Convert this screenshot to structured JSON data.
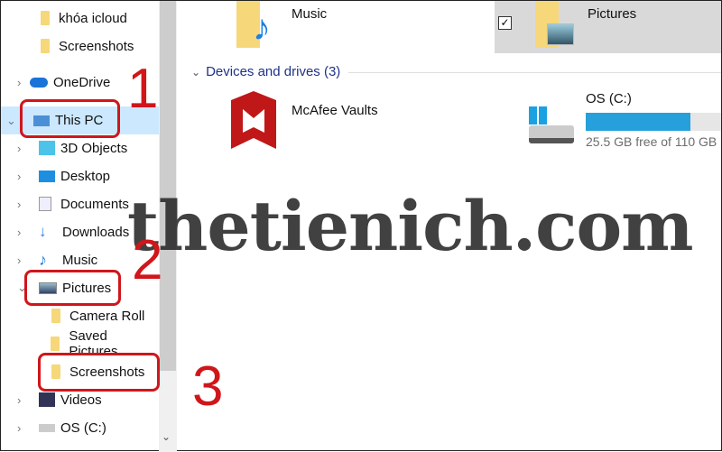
{
  "sidebar": {
    "items": [
      {
        "label": "khóa icloud",
        "icon": "folder-icon"
      },
      {
        "label": "Screenshots",
        "icon": "folder-icon"
      },
      {
        "label": "OneDrive",
        "icon": "cloud-icon"
      },
      {
        "label": "This PC",
        "icon": "computer-icon",
        "selected": true
      },
      {
        "label": "3D Objects",
        "icon": "cube-icon"
      },
      {
        "label": "Desktop",
        "icon": "desktop-icon"
      },
      {
        "label": "Documents",
        "icon": "document-icon"
      },
      {
        "label": "Downloads",
        "icon": "download-icon"
      },
      {
        "label": "Music",
        "icon": "music-icon"
      },
      {
        "label": "Pictures",
        "icon": "pictures-icon"
      },
      {
        "label": "Camera Roll",
        "icon": "folder-icon"
      },
      {
        "label": "Saved Pictures",
        "icon": "folder-icon"
      },
      {
        "label": "Screenshots",
        "icon": "folder-icon"
      },
      {
        "label": "Videos",
        "icon": "video-icon"
      },
      {
        "label": "OS (C:)",
        "icon": "drive-icon"
      }
    ]
  },
  "main": {
    "folders": [
      {
        "label": "Music"
      },
      {
        "label": "Pictures",
        "selected": true
      }
    ],
    "group_label": "Devices and drives (3)",
    "drives": [
      {
        "label": "McAfee Vaults"
      },
      {
        "label": "OS (C:)",
        "free_text": "25.5 GB free of 110 GB",
        "used_percent": 77
      }
    ]
  },
  "watermark": "thetienich.com",
  "annotations": [
    "1",
    "2",
    "3"
  ],
  "colors": {
    "selection": "#cce8ff",
    "accent": "#26a0da",
    "annotation": "#d0161b"
  }
}
